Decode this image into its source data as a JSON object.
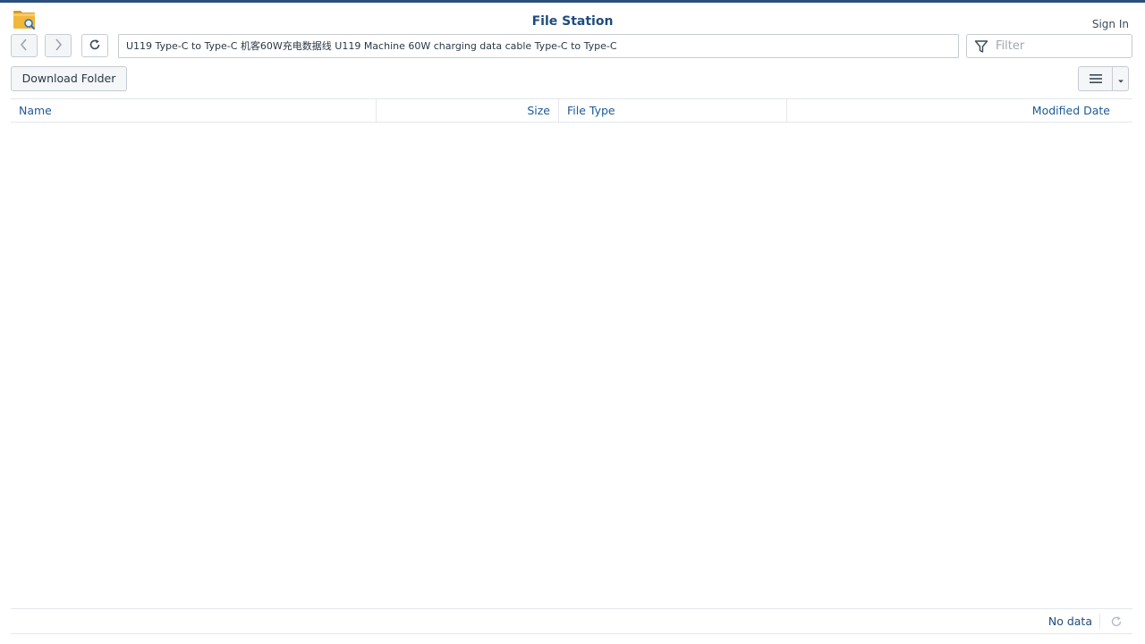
{
  "app": {
    "title": "File Station",
    "icon": "folder-search-icon",
    "signin_label": "Sign In"
  },
  "toolbar": {
    "back_icon": "chevron-left-icon",
    "forward_icon": "chevron-right-icon",
    "refresh_icon": "refresh-icon",
    "path": "U119 Type-C to Type-C 机客60W充电数据线 U119 Machine 60W charging data cable Type-C to Type-C",
    "filter_placeholder": "Filter",
    "filter_icon": "filter-icon",
    "download_folder_label": "Download Folder",
    "view_icon": "list-view-icon",
    "view_caret_icon": "caret-down-icon"
  },
  "grid": {
    "columns": [
      "Name",
      "Size",
      "File Type",
      "Modified Date"
    ],
    "rows": []
  },
  "footer": {
    "status": "No data",
    "refresh_icon": "refresh-icon"
  },
  "colors": {
    "accent": "#1e4c80",
    "header_text": "#1e5a96",
    "top_bar": "#2a4f7d",
    "folder_yellow": "#f0b73a"
  }
}
